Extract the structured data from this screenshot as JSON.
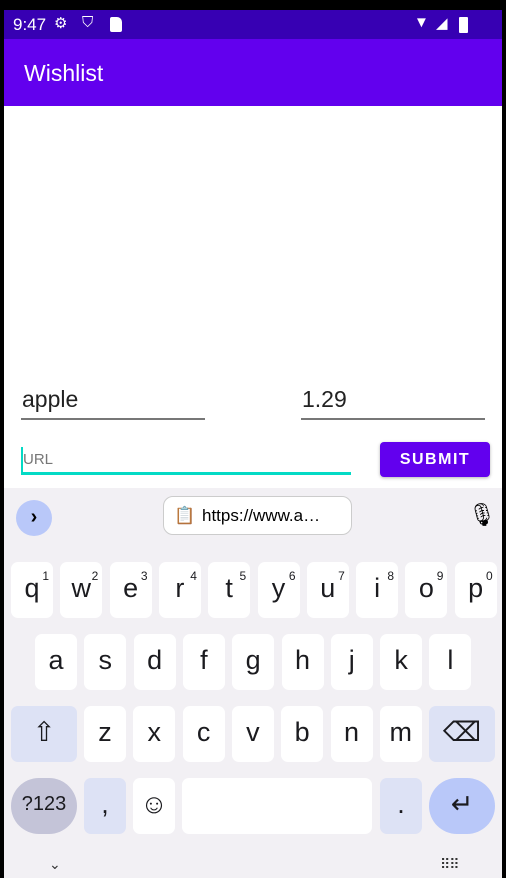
{
  "status_bar": {
    "time": "9:47",
    "icons": [
      "gear-icon",
      "shield-play-icon",
      "sd-card-icon",
      "wifi-icon",
      "signal-icon",
      "battery-icon"
    ]
  },
  "app_bar": {
    "title": "Wishlist"
  },
  "form": {
    "name_value": "apple",
    "price_value": "1.29",
    "url_placeholder": "URL",
    "submit_label": "SUBMIT"
  },
  "colors": {
    "primary": "#6200ee",
    "primary_dark": "#3700b3",
    "accent": "#03dac5"
  },
  "keyboard": {
    "clipboard_text": "https://www.a…",
    "row1": [
      {
        "k": "q",
        "n": "1"
      },
      {
        "k": "w",
        "n": "2"
      },
      {
        "k": "e",
        "n": "3"
      },
      {
        "k": "r",
        "n": "4"
      },
      {
        "k": "t",
        "n": "5"
      },
      {
        "k": "y",
        "n": "6"
      },
      {
        "k": "u",
        "n": "7"
      },
      {
        "k": "i",
        "n": "8"
      },
      {
        "k": "o",
        "n": "9"
      },
      {
        "k": "p",
        "n": "0"
      }
    ],
    "row2": [
      "a",
      "s",
      "d",
      "f",
      "g",
      "h",
      "j",
      "k",
      "l"
    ],
    "row3": [
      "z",
      "x",
      "c",
      "v",
      "b",
      "n",
      "m"
    ],
    "symbols": "?123",
    "comma": ",",
    "period": ".",
    "emoji": "☺"
  }
}
